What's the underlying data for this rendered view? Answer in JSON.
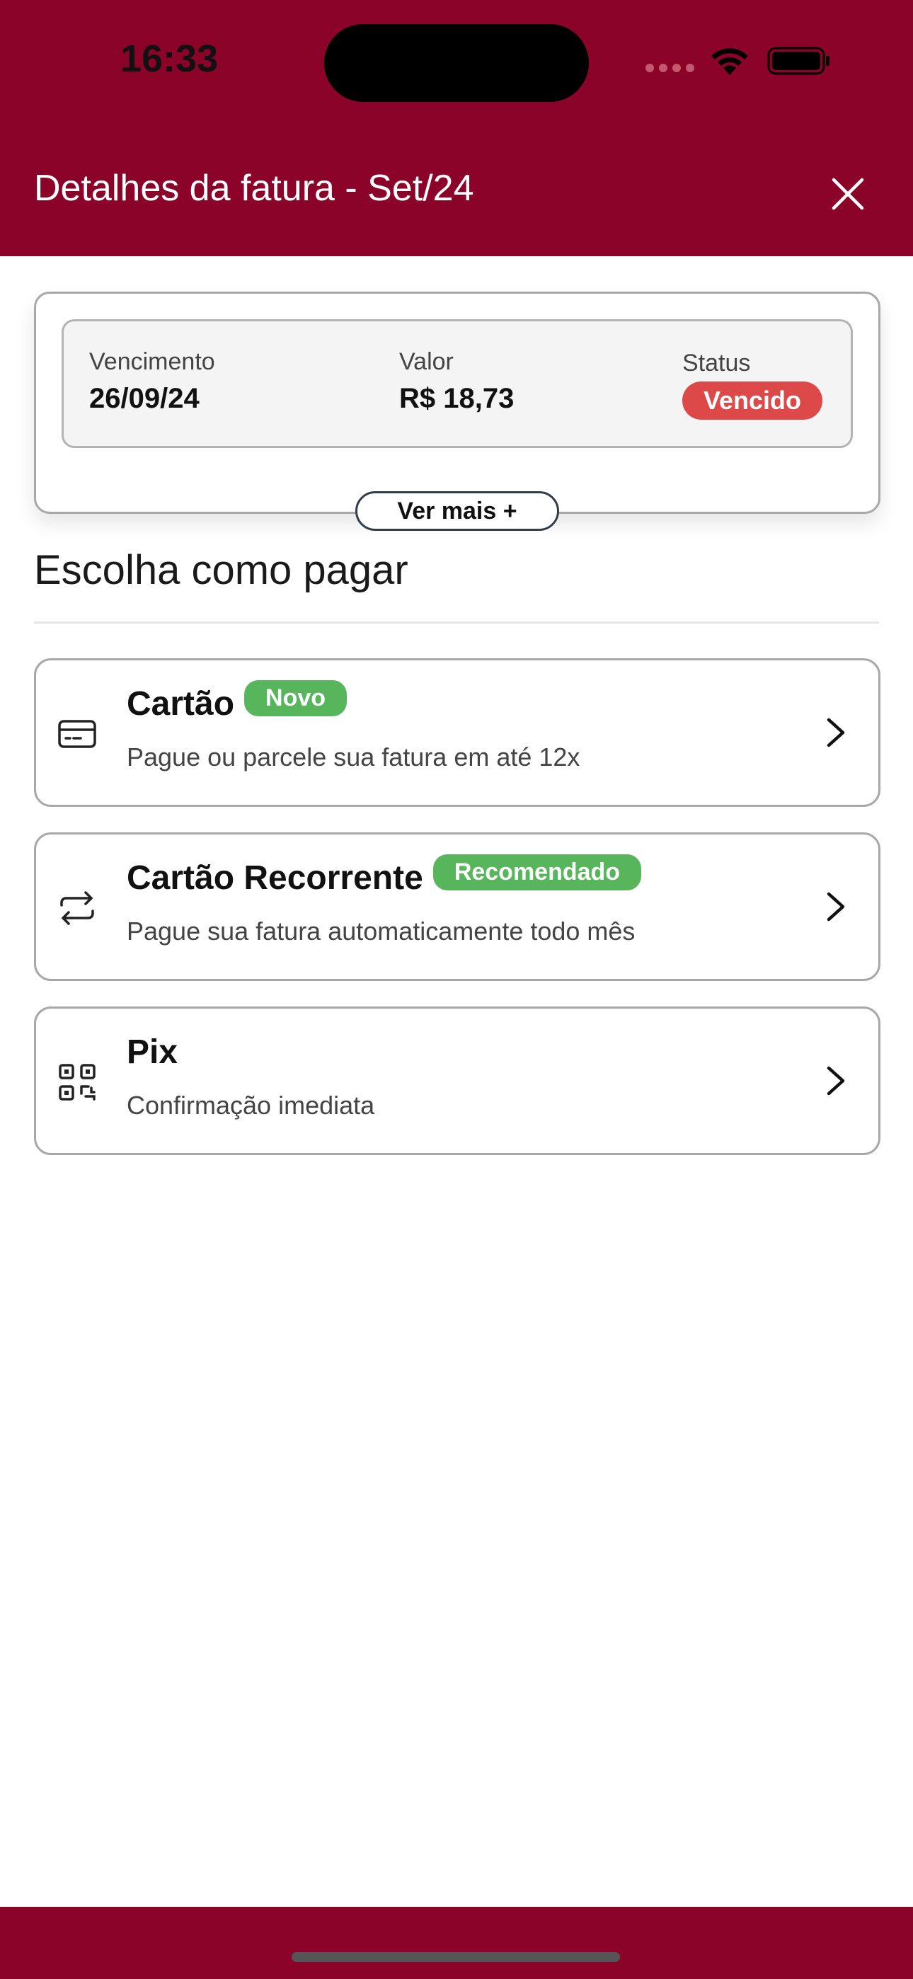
{
  "status_bar": {
    "time": "16:33"
  },
  "header": {
    "title": "Detalhes da fatura - Set/24"
  },
  "invoice": {
    "due_label": "Vencimento",
    "due_value": "26/09/24",
    "amount_label": "Valor",
    "amount_value": "R$ 18,73",
    "status_label": "Status",
    "status_value": "Vencido",
    "more_button": "Ver mais +"
  },
  "section_title": "Escolha como pagar",
  "options": [
    {
      "title": "Cartão",
      "tag": "Novo",
      "description": "Pague ou parcele sua fatura em até 12x",
      "icon": "credit-card-icon"
    },
    {
      "title": "Cartão Recorrente",
      "tag": "Recomendado",
      "description": "Pague sua fatura automaticamente todo mês",
      "icon": "repeat-icon"
    },
    {
      "title": "Pix",
      "description": "Confirmação imediata",
      "icon": "qr-code-icon"
    }
  ],
  "colors": {
    "brand": "#8c0329",
    "status_overdue": "#dd4848",
    "tag_green": "#57b65b"
  }
}
